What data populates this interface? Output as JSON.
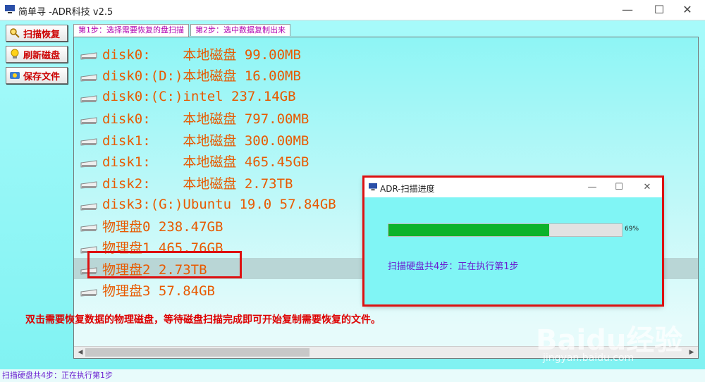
{
  "window": {
    "title": "简单寻  -ADR科技 v2.5",
    "minimize": "—",
    "maximize": "☐",
    "close": "✕"
  },
  "sidebar": {
    "buttons": [
      {
        "label": "扫描恢复",
        "icon": "magnifier-icon"
      },
      {
        "label": "刷新磁盘",
        "icon": "bulb-icon"
      },
      {
        "label": "保存文件",
        "icon": "save-icon"
      }
    ]
  },
  "tabs": [
    {
      "label": "第1步：选择需要恢复的盘扫描"
    },
    {
      "label": "第2步：选中数据复制出来"
    }
  ],
  "disks": [
    {
      "label": "disk0:    本地磁盘 99.00MB"
    },
    {
      "label": "disk0:(D:)本地磁盘 16.00MB"
    },
    {
      "label": "disk0:(C:)intel 237.14GB"
    },
    {
      "label": "disk0:    本地磁盘 797.00MB"
    },
    {
      "label": "disk1:    本地磁盘 300.00MB"
    },
    {
      "label": "disk1:    本地磁盘 465.45GB"
    },
    {
      "label": "disk2:    本地磁盘 2.73TB"
    },
    {
      "label": "disk3:(G:)Ubuntu 19.0 57.84GB"
    },
    {
      "label": "物理盘0 238.47GB"
    },
    {
      "label": "物理盘1 465.76GB"
    },
    {
      "label": "物理盘2 2.73TB",
      "selected": true
    },
    {
      "label": "物理盘3 57.84GB"
    }
  ],
  "annotation": "双击需要恢复数据的物理磁盘，等待磁盘扫描完成即可开始复制需要恢复的文件。",
  "status_text": "扫描硬盘共4步：正在执行第1步",
  "dialog": {
    "title": "ADR-扫描进度",
    "progress": 0.69,
    "progress_label": "69%",
    "message": "扫描硬盘共4步：正在执行第1步"
  },
  "watermark": {
    "brand": "Baidu经验",
    "url": "jingyan.baidu.com"
  },
  "colors": {
    "accent_red": "#d11111",
    "progress_green": "#0bb32a",
    "disk_text": "#e85a00"
  }
}
